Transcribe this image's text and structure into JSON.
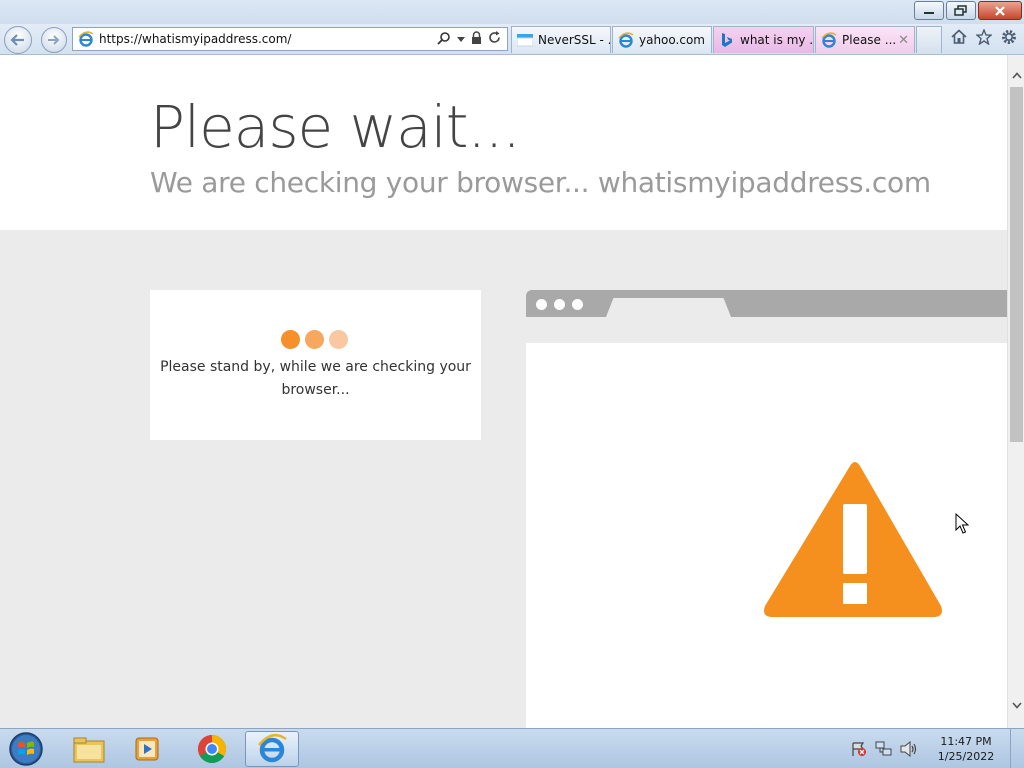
{
  "browser": {
    "url": "https://whatismyipaddress.com/",
    "tabs": [
      {
        "label": "NeverSSL - ..."
      },
      {
        "label": "yahoo.com"
      },
      {
        "label": "what is my ..."
      },
      {
        "label": "Please ..."
      }
    ],
    "close_tab_glyph": "✕"
  },
  "page": {
    "title": "Please wait...",
    "subtitle": "We are checking your browser... whatismyipaddress.com",
    "card_message": "Please stand by, while we are checking your browser...",
    "loader_colors": [
      "#f5902b",
      "#f7a75e",
      "#fac8a0"
    ],
    "accent_color": "#f5901f"
  },
  "taskbar": {
    "time": "11:47 PM",
    "date": "1/25/2022"
  }
}
